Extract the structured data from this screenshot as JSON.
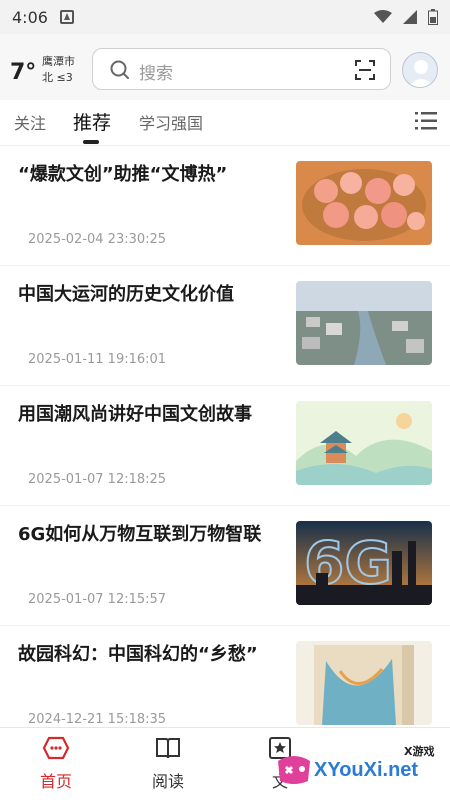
{
  "status_bar": {
    "time": "4:06"
  },
  "weather": {
    "temperature": "7°",
    "city": "鹰潭市",
    "wind": "北 ≤3"
  },
  "search": {
    "placeholder": "搜索"
  },
  "tabs": [
    {
      "label": "关注"
    },
    {
      "label": "推荐",
      "active": true
    },
    {
      "label": "学习强国"
    }
  ],
  "articles": [
    {
      "title": "“爆款文创”助推“文博热”",
      "date": "2025-02-04 23:30:25"
    },
    {
      "title": "中国大运河的历史文化价值",
      "date": "2025-01-11 19:16:01"
    },
    {
      "title": "用国潮风尚讲好中国文创故事",
      "date": "2025-01-07 12:18:25"
    },
    {
      "title": "6G如何从万物互联到万物智联",
      "date": "2025-01-07 12:15:57"
    },
    {
      "title": "故园科幻：中国科幻的“乡愁”",
      "date": "2024-12-21 15:18:35"
    }
  ],
  "bottom_nav": [
    {
      "label": "首页",
      "icon": "home-icon",
      "active": true
    },
    {
      "label": "阅读",
      "icon": "book-icon"
    },
    {
      "label": "文",
      "icon": "star-doc-icon"
    }
  ],
  "watermark": {
    "text": "XYouXi.net",
    "small": "X游戏"
  },
  "colors": {
    "accent": "#d22b2b",
    "watermark": "#2a7bd8"
  }
}
